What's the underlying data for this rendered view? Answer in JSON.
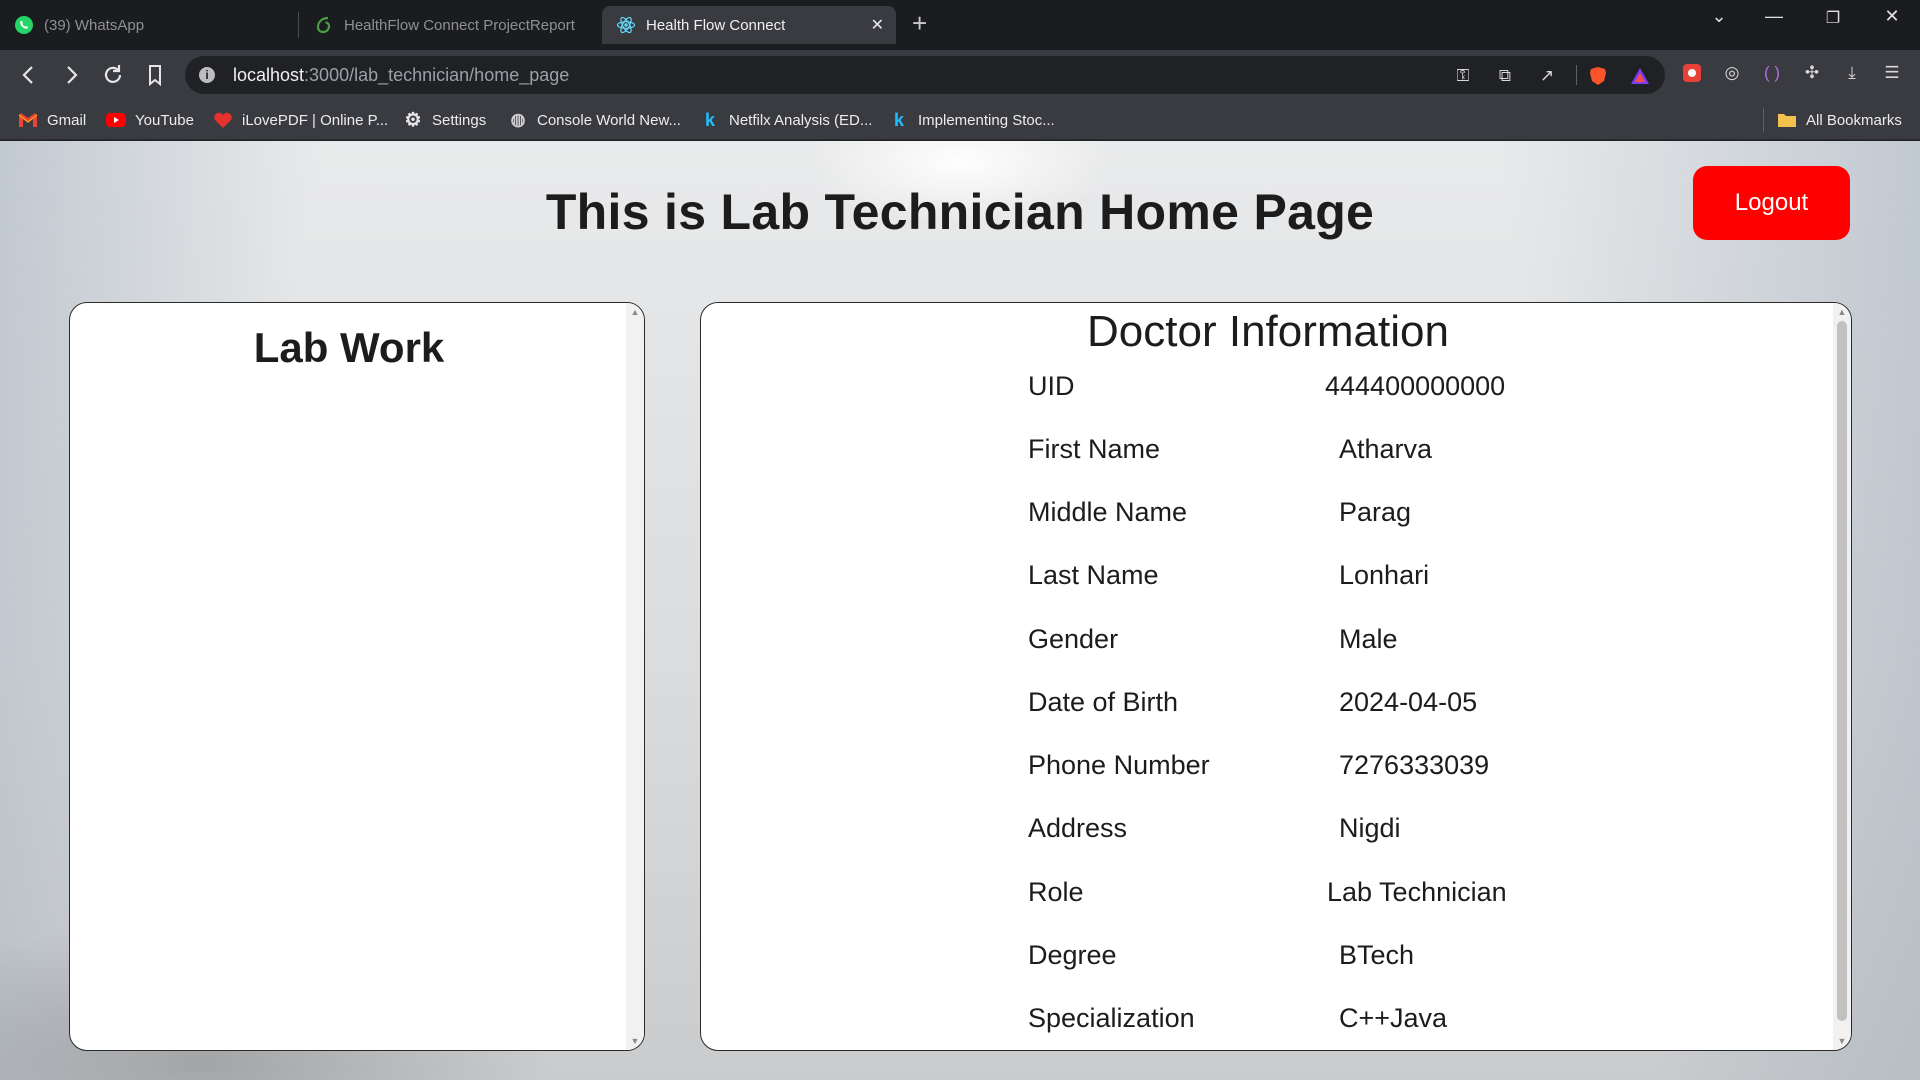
{
  "browser": {
    "tabs": [
      {
        "title": "(39) WhatsApp",
        "active": false,
        "icon": "whatsapp-icon"
      },
      {
        "title": "HealthFlow Connect ProjectReport -",
        "active": false,
        "icon": "overleaf-icon"
      },
      {
        "title": "Health Flow Connect",
        "active": true,
        "icon": "react-icon"
      }
    ],
    "url_host": "localhost",
    "url_path": ":3000/lab_technician/home_page",
    "bookmarks": [
      {
        "label": "Gmail",
        "icon": "gmail-icon"
      },
      {
        "label": "YouTube",
        "icon": "youtube-icon"
      },
      {
        "label": "iLovePDF | Online P...",
        "icon": "ilovepdf-icon"
      },
      {
        "label": "Settings",
        "icon": "gear-icon"
      },
      {
        "label": "Console World New...",
        "icon": "globe-icon"
      },
      {
        "label": "Netfilx Analysis (ED...",
        "icon": "kaggle-icon"
      },
      {
        "label": "Implementing Stoc...",
        "icon": "kaggle-icon"
      }
    ],
    "all_bookmarks_label": "All Bookmarks"
  },
  "page": {
    "title": "This is Lab Technician Home Page",
    "logout_label": "Logout",
    "lab_work": {
      "heading": "Lab Work"
    },
    "doctor_info": {
      "heading": "Doctor Information",
      "rows": [
        {
          "label": "UID",
          "value": "444400000000"
        },
        {
          "label": "First Name",
          "value": "Atharva"
        },
        {
          "label": "Middle Name",
          "value": "Parag"
        },
        {
          "label": "Last Name",
          "value": "Lonhari"
        },
        {
          "label": "Gender",
          "value": "Male"
        },
        {
          "label": "Date of Birth",
          "value": "2024-04-05"
        },
        {
          "label": "Phone Number",
          "value": "7276333039"
        },
        {
          "label": "Address",
          "value": "Nigdi"
        },
        {
          "label": "Role",
          "value": "Lab Technician"
        },
        {
          "label": "Degree",
          "value": "BTech"
        },
        {
          "label": "Specialization",
          "value": "C++Java"
        }
      ]
    }
  },
  "colors": {
    "logout_bg": "#ff0000",
    "chrome_dark": "#1b1c20",
    "chrome_toolbar": "#3a3b40"
  }
}
